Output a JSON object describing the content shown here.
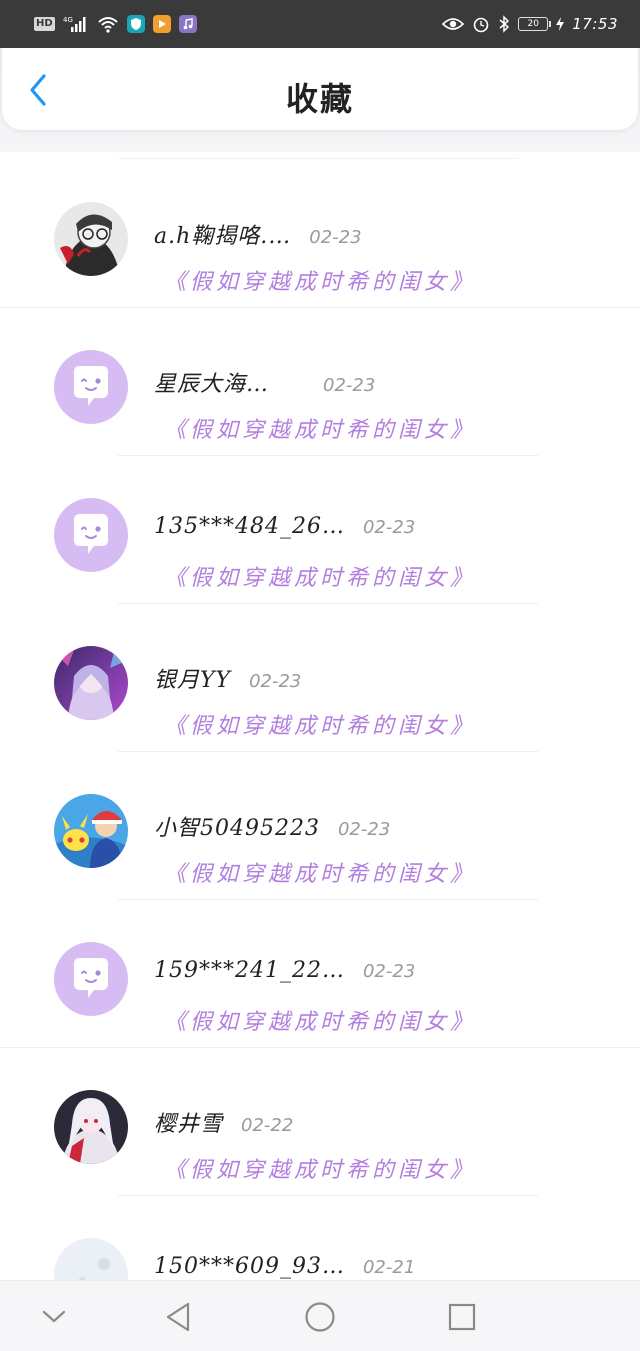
{
  "status_bar": {
    "left_badge": "HD",
    "network": "4G",
    "time": "17:53",
    "battery": "20"
  },
  "header": {
    "title": "收藏",
    "back_icon": "chevron-left-icon"
  },
  "colors": {
    "accent_blue": "#2196f3",
    "subtitle_purple": "#b27fe0",
    "default_avatar_bg": "#d6bcf3",
    "status_bar_bg": "#3a3a3a"
  },
  "items": [
    {
      "name": "a.h鞠揭咯.…",
      "date": "02-23",
      "subtitle": "《假如穿越成时希的闺女》",
      "avatar": "photo-avatar"
    },
    {
      "name": "星辰大海…",
      "date": "02-23",
      "subtitle": "《假如穿越成时希的闺女》",
      "avatar": "default-chat-avatar"
    },
    {
      "name": "135***484_26…",
      "date": "02-23",
      "subtitle": "《假如穿越成时希的闺女》",
      "avatar": "default-chat-avatar"
    },
    {
      "name": "银月YY",
      "date": "02-23",
      "subtitle": "《假如穿越成时希的闺女》",
      "avatar": "photo-avatar"
    },
    {
      "name": "小智50495223",
      "date": "02-23",
      "subtitle": "《假如穿越成时希的闺女》",
      "avatar": "photo-avatar"
    },
    {
      "name": "159***241_22…",
      "date": "02-23",
      "subtitle": "《假如穿越成时希的闺女》",
      "avatar": "default-chat-avatar"
    },
    {
      "name": "樱井雪",
      "date": "02-22",
      "subtitle": "《假如穿越成时希的闺女》",
      "avatar": "photo-avatar"
    },
    {
      "name": "150***609_93…",
      "date": "02-21",
      "subtitle": "",
      "avatar": "placeholder-image-avatar"
    }
  ],
  "nav_bar": {
    "icons": [
      "chevron-down-icon",
      "back-triangle-icon",
      "home-circle-icon",
      "recents-square-icon"
    ]
  }
}
